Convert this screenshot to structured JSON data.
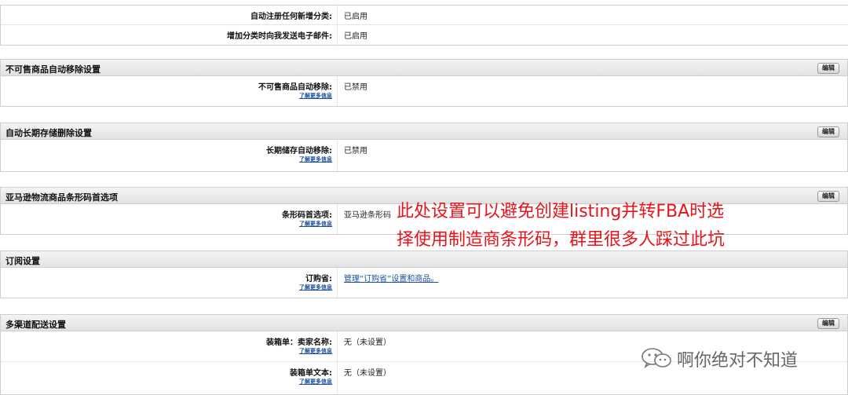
{
  "top": {
    "rows": [
      {
        "label": "自动注册任何新增分类:",
        "value": "已启用"
      },
      {
        "label": "增加分类时向我发送电子邮件:",
        "value": "已启用"
      }
    ]
  },
  "sections": [
    {
      "title": "不可售商品自动移除设置",
      "edit": "编辑",
      "rows": [
        {
          "label": "不可售商品自动移除:",
          "more": "了解更多信息",
          "value": "已禁用"
        }
      ]
    },
    {
      "title": "自动长期存储删除设置",
      "edit": "编辑",
      "rows": [
        {
          "label": "长期储存自动移除:",
          "more": "了解更多信息",
          "value": "已禁用"
        }
      ]
    },
    {
      "title": "亚马逊物流商品条形码首选项",
      "edit": "编辑",
      "rows": [
        {
          "label": "条形码首选项:",
          "more": "了解更多信息",
          "value": "亚马逊条形码"
        }
      ]
    },
    {
      "title": "订阅设置",
      "rows": [
        {
          "label": "订购省:",
          "more": "了解更多信息",
          "value": "管理“订购省”设置和商品。"
        }
      ]
    },
    {
      "title": "多渠道配送设置",
      "edit": "编辑",
      "rows": [
        {
          "label": "装箱单：卖家名称:",
          "more": "了解更多信息",
          "value": "无（未设置）"
        },
        {
          "label": "装箱单文本:",
          "more": "了解更多信息",
          "value": "无（未设置）"
        }
      ]
    }
  ],
  "annotation": {
    "line1": "此处设置可以避免创建listing并转FBA时选",
    "line2": "择使用制造商条形码，群里很多人踩过此坑",
    "color": "#e8141c"
  },
  "watermark": {
    "icon": "wechat-icon",
    "text": "啊你绝对不知道"
  }
}
